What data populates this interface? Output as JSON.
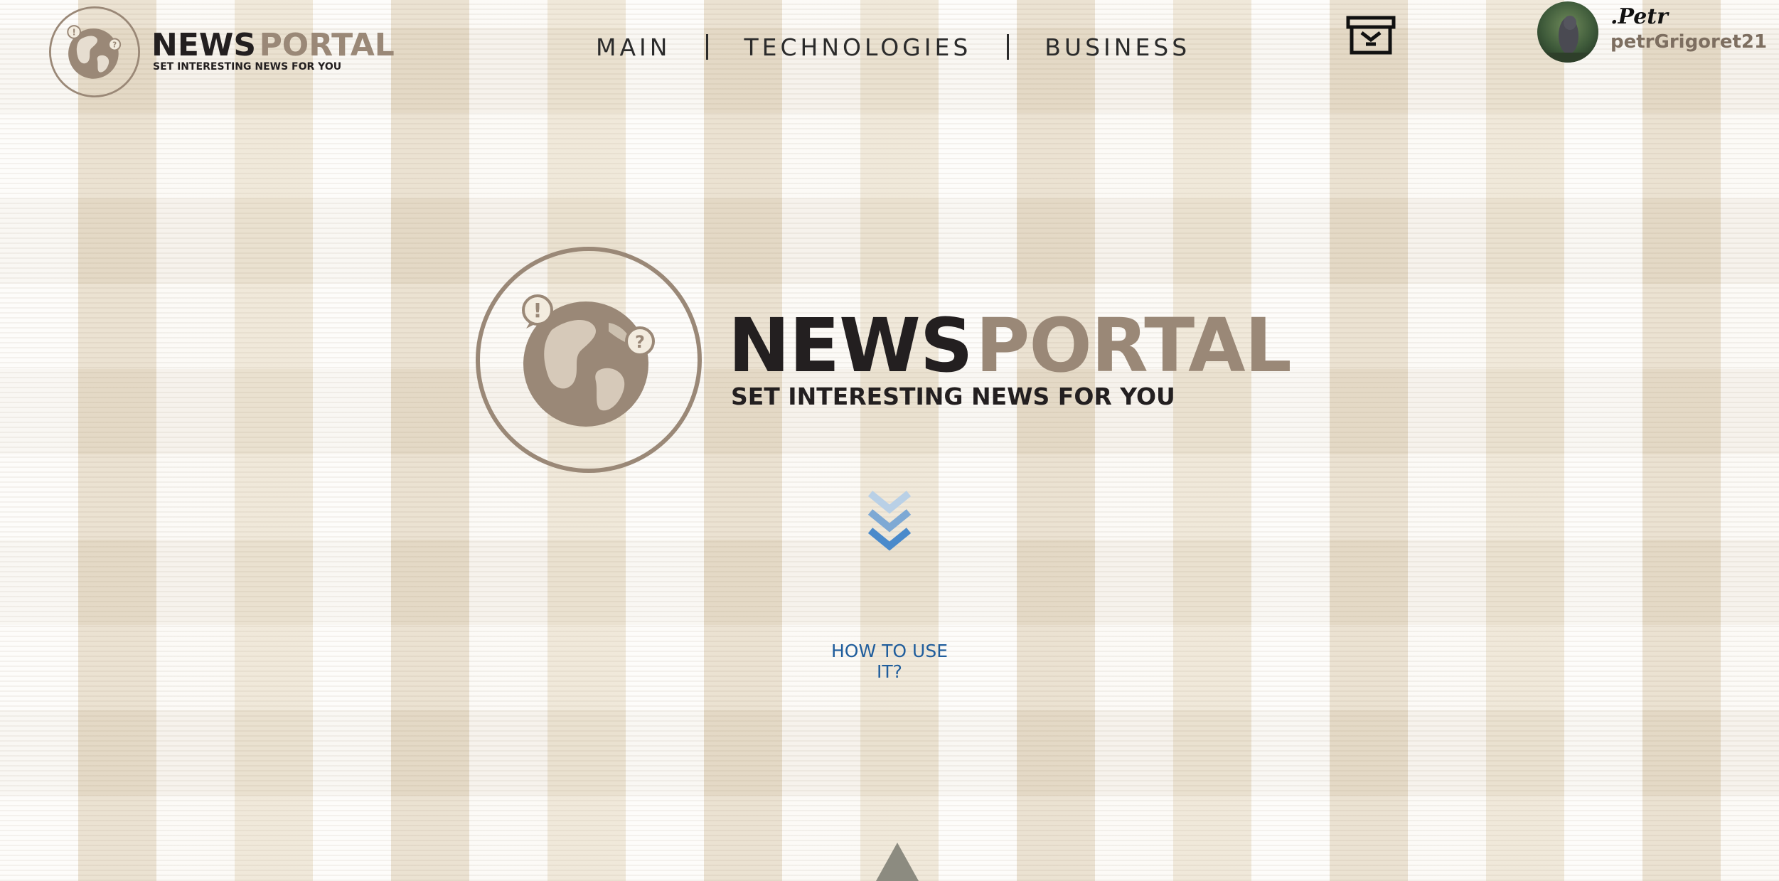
{
  "brand": {
    "name_part1": "NEWS",
    "name_part2": "PORTAL",
    "tagline": "SET INTERESTING NEWS FOR YOU"
  },
  "nav": {
    "items": [
      {
        "label": "MAIN"
      },
      {
        "label": "TECHNOLOGIES"
      },
      {
        "label": "BUSINESS"
      }
    ]
  },
  "user": {
    "name": ".Petr",
    "handle": "petrGrigoret21"
  },
  "hero": {
    "name_part1": "NEWS",
    "name_part2": "PORTAL",
    "tagline": "SET INTERESTING NEWS FOR YOU"
  },
  "help_link": "HOW TO USE IT?",
  "icons": {
    "logo": "globe-speech-bubbles-icon",
    "archive": "archive-box-icon",
    "scroll_down": "triple-chevron-down-icon",
    "scroll_up": "triangle-up-icon"
  },
  "colors": {
    "brand_dark": "#231f20",
    "brand_taupe": "#9a8877",
    "link_blue": "#1f5d9c",
    "chevron_blue": "#4a8acb"
  }
}
